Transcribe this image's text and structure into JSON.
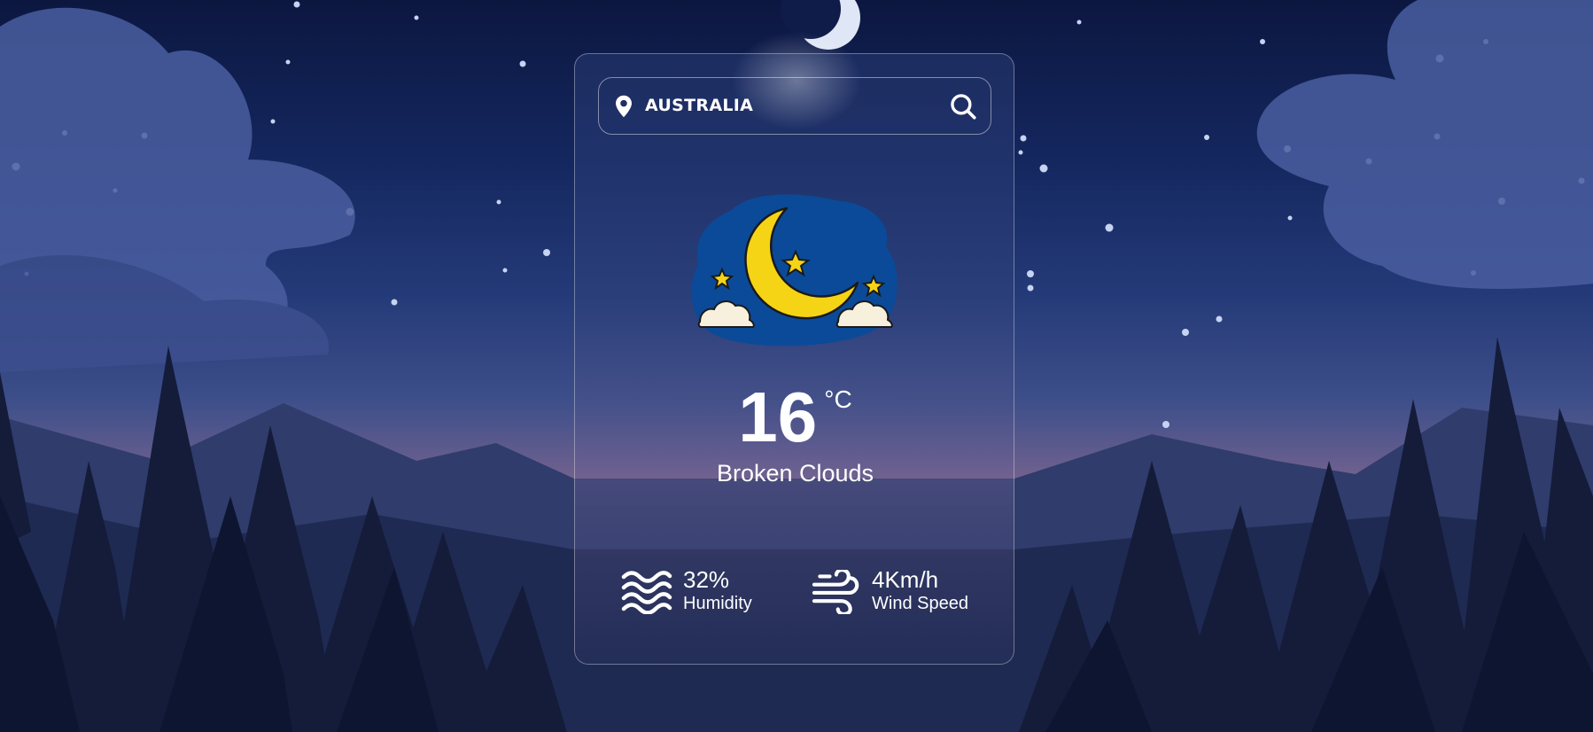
{
  "search": {
    "value": "AUSTRALIA",
    "pin_icon": "map-pin-icon",
    "search_icon": "magnifier-icon"
  },
  "weather": {
    "icon": "moon-stars-clouds-icon",
    "temperature": "16",
    "unit": "°C",
    "condition": "Broken Clouds"
  },
  "stats": {
    "humidity": {
      "icon": "waves-icon",
      "value": "32%",
      "label": "Humidity"
    },
    "wind": {
      "icon": "wind-icon",
      "value": "4Km/h",
      "label": "Wind Speed"
    }
  },
  "colors": {
    "text": "#ffffff",
    "moon": "#f5d416",
    "icon_bg": "#0b4a98",
    "sky_top": "#0c1740"
  }
}
